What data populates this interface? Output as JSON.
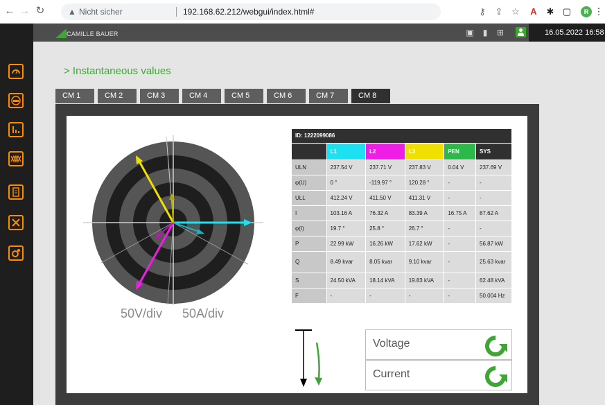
{
  "browser": {
    "security_label": "Nicht sicher",
    "url": "192.168.62.212/webgui/index.html#",
    "profile_initial": "R"
  },
  "header": {
    "brand": "CAMILLE BAUER",
    "datetime": "16.05.2022  16:58"
  },
  "page": {
    "title": "> Instantaneous values"
  },
  "tabs": [
    {
      "label": "CM 1"
    },
    {
      "label": "CM 2"
    },
    {
      "label": "CM 3"
    },
    {
      "label": "CM 4"
    },
    {
      "label": "CM 5"
    },
    {
      "label": "CM 6"
    },
    {
      "label": "CM 7"
    },
    {
      "label": "CM 8"
    }
  ],
  "active_tab": "CM 8",
  "phasor": {
    "voltage_scale": "50V/div",
    "current_scale": "50A/div",
    "colors": {
      "L1": "#1de0f0",
      "L2": "#ee1ee6",
      "L3": "#f0e000",
      "ring_dark": "#1e1e1e",
      "ring_light": "#555555"
    }
  },
  "table": {
    "id_label": "ID: 1222099086",
    "columns": [
      "",
      "L1",
      "L2",
      "L3",
      "PEN",
      "SYS"
    ],
    "rows": [
      {
        "name": "ULN",
        "cells": [
          "237.54 V",
          "237.71 V",
          "237.83 V",
          "0.04 V",
          "237.69 V"
        ]
      },
      {
        "name": "φ(U)",
        "cells": [
          "0 °",
          "-119.97 °",
          "120.28 °",
          "-",
          "-"
        ]
      },
      {
        "name": "ULL",
        "cells": [
          "412.24 V",
          "411.50 V",
          "411.31 V",
          "-",
          "-"
        ]
      },
      {
        "name": "I",
        "cells": [
          "103.16 A",
          "76.32 A",
          "83.39 A",
          "16.75 A",
          "87.62 A"
        ]
      },
      {
        "name": "φ(I)",
        "cells": [
          "19.7 °",
          "25.8 °",
          "26.7 °",
          "-",
          "-"
        ]
      },
      {
        "name": "P",
        "cells": [
          "22.99 kW",
          "16.26 kW",
          "17.62 kW",
          "-",
          "56.87 kW"
        ]
      },
      {
        "name": "Q",
        "cells": [
          "8.49 kvar",
          "8.05 kvar",
          "9.10 kvar",
          "-",
          "25.63 kvar"
        ]
      },
      {
        "name": "S",
        "cells": [
          "24.50 kVA",
          "18.14 kVA",
          "19.83 kVA",
          "-",
          "62.48 kVA"
        ]
      },
      {
        "name": "F",
        "cells": [
          "-",
          "-",
          "-",
          "-",
          "50.004 Hz"
        ]
      }
    ]
  },
  "legend": {
    "voltage_label": "Voltage",
    "current_label": "Current",
    "refresh_color": "#3fa535"
  }
}
